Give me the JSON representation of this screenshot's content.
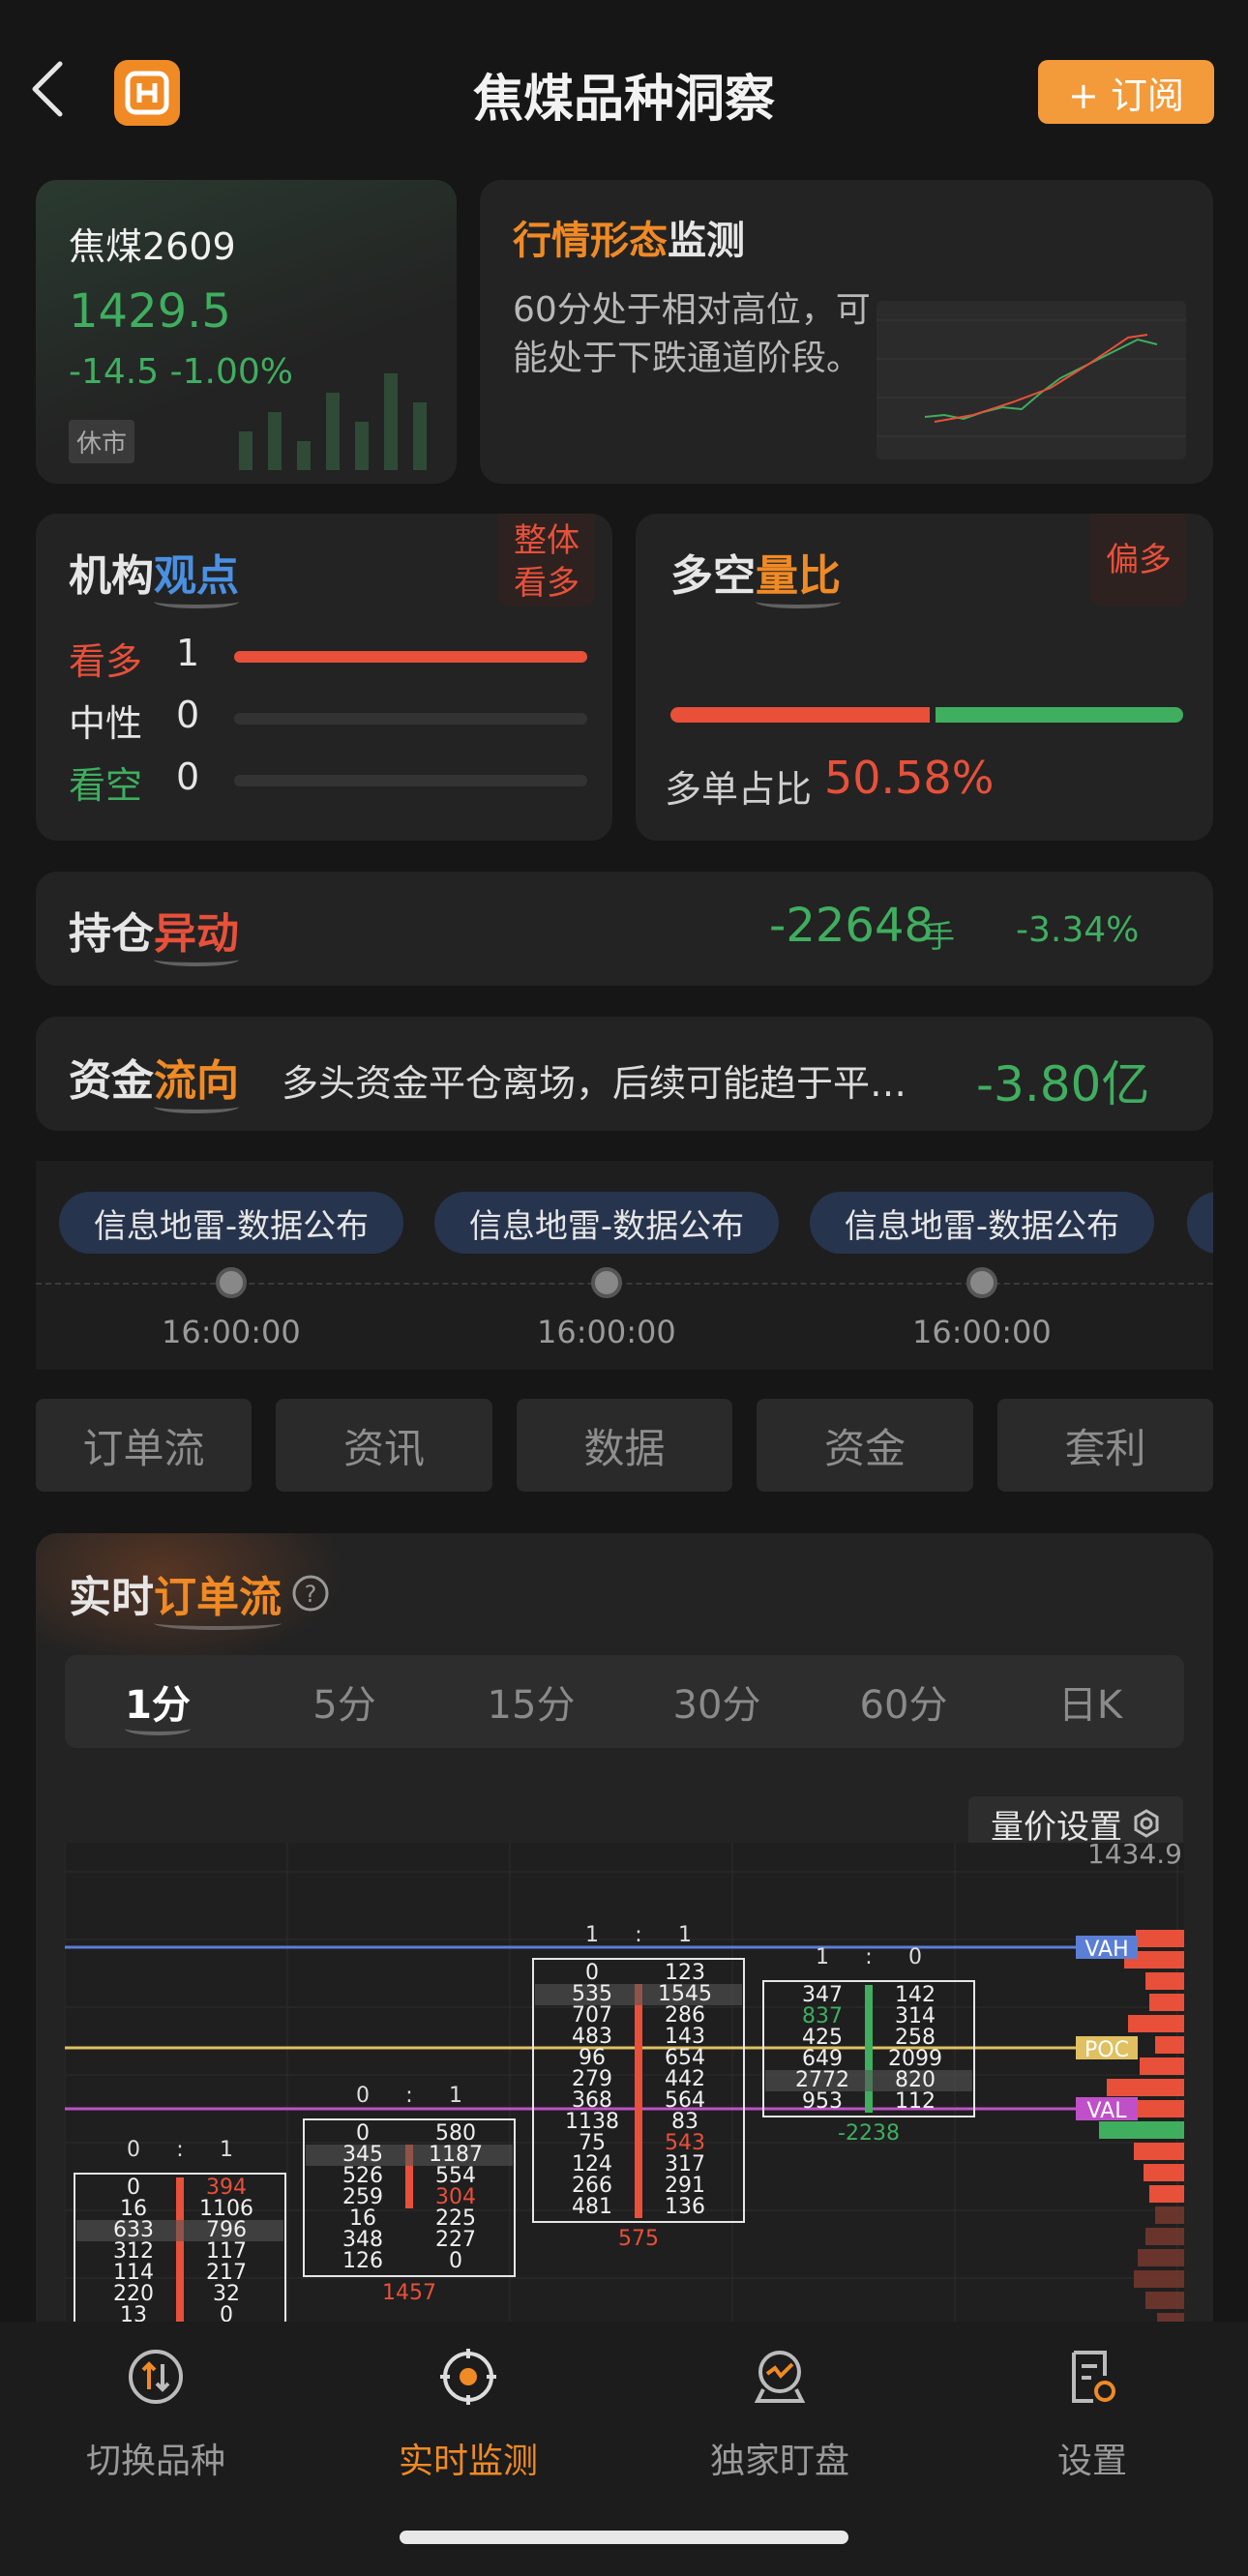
{
  "header": {
    "title": "焦煤品种洞察",
    "subscribe_label": "+ 订阅"
  },
  "price": {
    "name": "焦煤2609",
    "last": "1429.5",
    "change": "-14.5",
    "change_pct": "-1.00%",
    "status": "休市"
  },
  "trend": {
    "title_hl": "行情形态",
    "title_rest": "监测",
    "desc": "60分处于相对高位，可能处于下跌通道阶段。"
  },
  "institution": {
    "title_a": "机构",
    "title_b": "观点",
    "badge": "整体看多",
    "rows": [
      {
        "label": "看多",
        "count": "1",
        "ratio": 1.0
      },
      {
        "label": "中性",
        "count": "0",
        "ratio": 0
      },
      {
        "label": "看空",
        "count": "0",
        "ratio": 0
      }
    ]
  },
  "ratio": {
    "title_a": "多空",
    "title_b": "量比",
    "badge": "偏多",
    "label": "多单占比",
    "value": "50.58%",
    "long_fraction": 0.5058
  },
  "position": {
    "title_a": "持仓",
    "title_b": "异动",
    "value": "-22648",
    "unit": "手",
    "pct": "-3.34%"
  },
  "fund": {
    "title_a": "资金",
    "title_b": "流向",
    "desc": "多头资金平仓离场，后续可能趋于平…",
    "value": "-3.80亿"
  },
  "events": [
    {
      "label": "信息地雷-数据公布",
      "time": "16:00:00"
    },
    {
      "label": "信息地雷-数据公布",
      "time": "16:00:00"
    },
    {
      "label": "信息地雷-数据公布",
      "time": "16:00:00"
    }
  ],
  "tabs": [
    "订单流",
    "资讯",
    "数据",
    "资金",
    "套利"
  ],
  "orderflow": {
    "title_a": "实时",
    "title_b": "订单流",
    "periods": [
      "1分",
      "5分",
      "15分",
      "30分",
      "60分",
      "日K"
    ],
    "active_period": "1分",
    "settings_label": "量价设置",
    "price_top": "1434.9",
    "level_labels": {
      "vah": "VAH",
      "poc": "POC",
      "val": "VAL"
    },
    "colors": {
      "accent": "#f08a24",
      "up": "#e8503a",
      "down": "#3fae5f",
      "vah": "#5b7fd6",
      "poc": "#e0c060",
      "val": "#c050c8"
    }
  },
  "footprints": [
    {
      "ratio": [
        "0",
        ":",
        "1"
      ],
      "delta": "",
      "rows": [
        [
          "0",
          "394"
        ],
        [
          "16",
          "1106"
        ],
        [
          "633",
          "796"
        ],
        [
          "312",
          "117"
        ],
        [
          "114",
          "217"
        ],
        [
          "220",
          "32"
        ],
        [
          "13",
          "0"
        ]
      ]
    },
    {
      "ratio": [
        "0",
        ":",
        "1"
      ],
      "delta": "1457",
      "rows": [
        [
          "0",
          "580"
        ],
        [
          "345",
          "1187"
        ],
        [
          "526",
          "554"
        ],
        [
          "259",
          "304"
        ],
        [
          "16",
          "225"
        ],
        [
          "348",
          "227"
        ],
        [
          "126",
          "0"
        ]
      ]
    },
    {
      "ratio": [
        "1",
        ":",
        "1"
      ],
      "delta": "575",
      "rows": [
        [
          "0",
          "123"
        ],
        [
          "535",
          "1545"
        ],
        [
          "707",
          "286"
        ],
        [
          "483",
          "143"
        ],
        [
          "96",
          "654"
        ],
        [
          "279",
          "442"
        ],
        [
          "368",
          "564"
        ],
        [
          "1138",
          "83"
        ],
        [
          "75",
          "543"
        ],
        [
          "124",
          "317"
        ],
        [
          "266",
          "291"
        ],
        [
          "481",
          "136"
        ]
      ]
    },
    {
      "ratio": [
        "1",
        ":",
        "0"
      ],
      "delta": "-2238",
      "rows": [
        [
          "347",
          "142"
        ],
        [
          "837",
          "314"
        ],
        [
          "425",
          "258"
        ],
        [
          "649",
          "2099"
        ],
        [
          "2772",
          "820"
        ],
        [
          "953",
          "112"
        ]
      ]
    }
  ],
  "nav": [
    {
      "label": "切换品种",
      "icon": "switch-icon"
    },
    {
      "label": "实时监测",
      "icon": "monitor-icon"
    },
    {
      "label": "独家盯盘",
      "icon": "watch-icon"
    },
    {
      "label": "设置",
      "icon": "settings-doc-icon"
    }
  ]
}
